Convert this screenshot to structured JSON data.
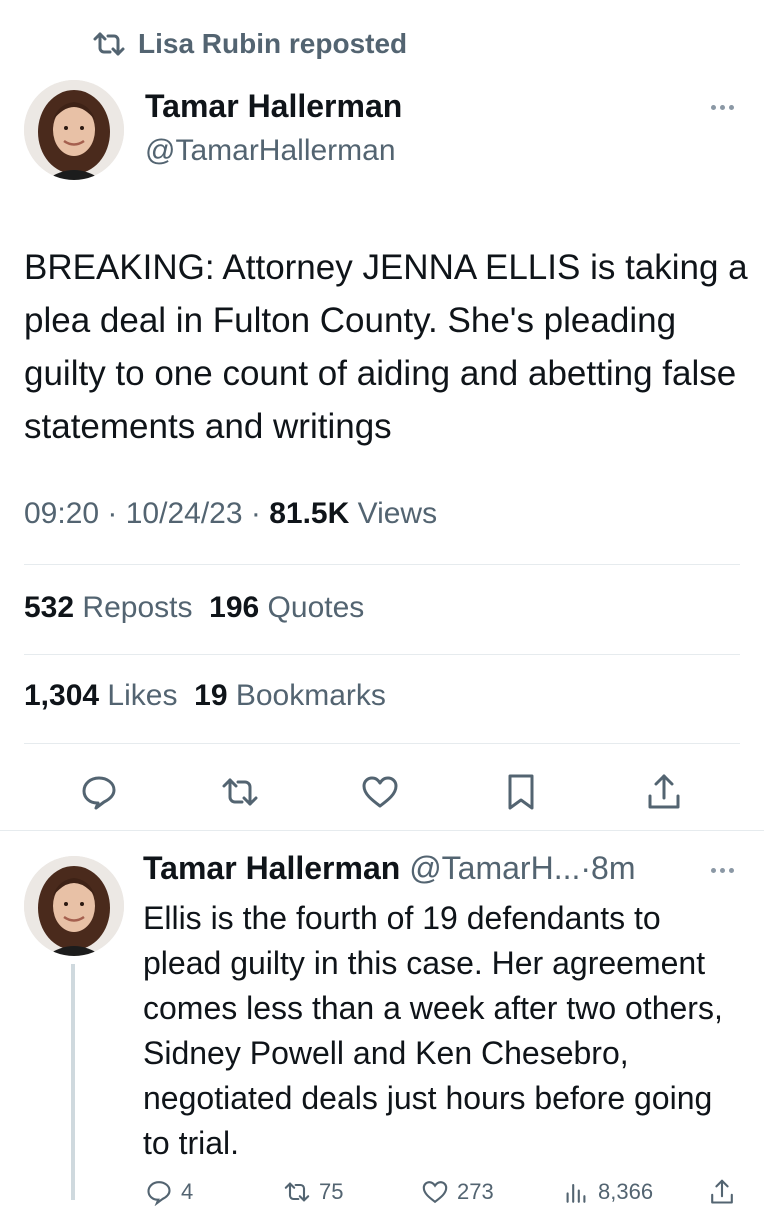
{
  "repost": {
    "text": "Lisa Rubin reposted"
  },
  "tweet": {
    "author_name": "Tamar Hallerman",
    "author_handle": "@TamarHallerman",
    "text": "BREAKING: Attorney JENNA ELLIS is taking a plea deal in Fulton County. She's pleading guilty to one count of aiding and abetting false statements and writings",
    "time": "09:20",
    "date": "10/24/23",
    "views_count": "81.5K",
    "views_label": "Views",
    "reposts_count": "532",
    "reposts_label": "Reposts",
    "quotes_count": "196",
    "quotes_label": "Quotes",
    "likes_count": "1,304",
    "likes_label": "Likes",
    "bookmarks_count": "19",
    "bookmarks_label": "Bookmarks"
  },
  "reply": {
    "author_name": "Tamar Hallerman",
    "author_handle": "@TamarH...",
    "age": "8m",
    "text": "Ellis is the fourth of 19 defendants to plead guilty in this case. Her agreement comes less than a week after two others, Sidney Powell and Ken Chesebro, negotiated deals just hours before going to trial.",
    "replies": "4",
    "reposts": "75",
    "likes": "273",
    "views": "8,366"
  },
  "icons": {
    "repost": "repost-icon",
    "reply": "reply-icon",
    "like": "heart-icon",
    "bookmark": "bookmark-icon",
    "share": "share-icon",
    "views": "views-icon",
    "more": "more-icon"
  },
  "colors": {
    "text": "#0f1419",
    "secondary": "#536471",
    "divider": "#e6ebee",
    "thread_line": "#cfd9de"
  }
}
